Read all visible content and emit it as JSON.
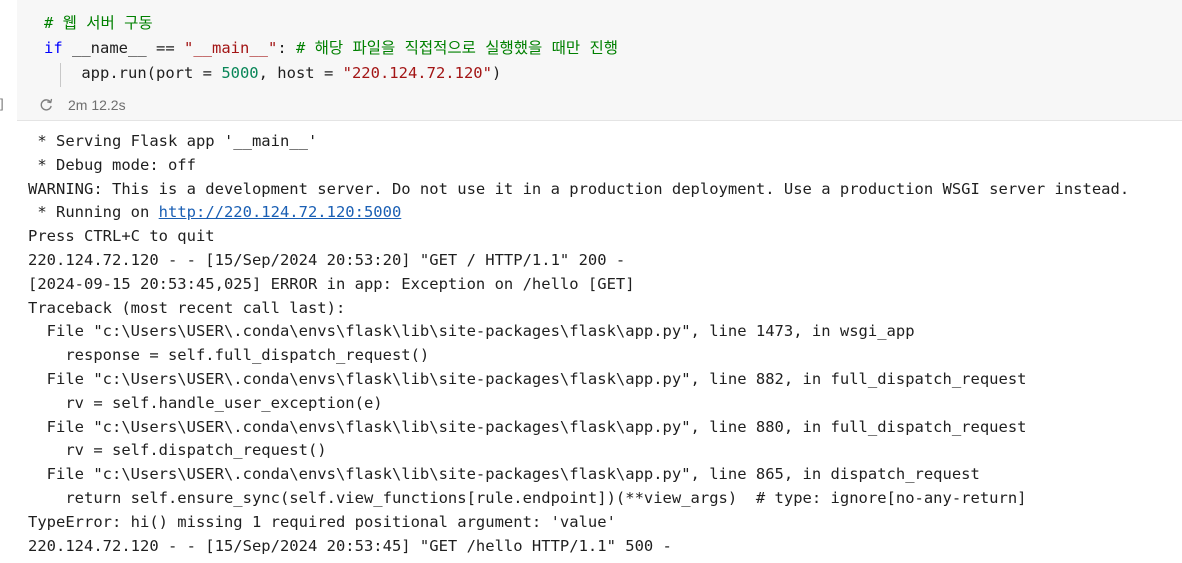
{
  "cell": {
    "code_lines": [
      [
        {
          "text": "# 웹 서버 구동",
          "style": "comment"
        }
      ],
      [
        {
          "text": "if",
          "style": "keyword"
        },
        {
          "text": " __name__ == ",
          "style": "plain"
        },
        {
          "text": "\"__main__\"",
          "style": "string"
        },
        {
          "text": ": ",
          "style": "plain"
        },
        {
          "text": "# 해당 파일을 직접적으로 실행했을 때만 진행",
          "style": "comment"
        }
      ],
      [
        {
          "text": "    app.run(port = ",
          "style": "plain"
        },
        {
          "text": "5000",
          "style": "number"
        },
        {
          "text": ", host = ",
          "style": "plain"
        },
        {
          "text": "\"220.124.72.120\"",
          "style": "string"
        },
        {
          "text": ")",
          "style": "plain"
        }
      ]
    ],
    "exec_time": "2m 12.2s",
    "status_icon": "refresh-icon",
    "left_marker": "]"
  },
  "colors": {
    "comment": "#008000",
    "keyword": "#0000ff",
    "string": "#a31515",
    "number": "#098658",
    "link": "#1a5fb4"
  },
  "output": {
    "lines": [
      {
        "text": " * Serving Flask app '__main__'"
      },
      {
        "text": " * Debug mode: off"
      },
      {
        "text": "WARNING: This is a development server. Do not use it in a production deployment. Use a production WSGI server instead."
      },
      {
        "prefix": " * Running on ",
        "link": "http://220.124.72.120:5000"
      },
      {
        "text": "Press CTRL+C to quit"
      },
      {
        "text": "220.124.72.120 - - [15/Sep/2024 20:53:20] \"GET / HTTP/1.1\" 200 -"
      },
      {
        "text": "[2024-09-15 20:53:45,025] ERROR in app: Exception on /hello [GET]"
      },
      {
        "text": "Traceback (most recent call last):"
      },
      {
        "text": "  File \"c:\\Users\\USER\\.conda\\envs\\flask\\lib\\site-packages\\flask\\app.py\", line 1473, in wsgi_app"
      },
      {
        "text": "    response = self.full_dispatch_request()"
      },
      {
        "text": "  File \"c:\\Users\\USER\\.conda\\envs\\flask\\lib\\site-packages\\flask\\app.py\", line 882, in full_dispatch_request"
      },
      {
        "text": "    rv = self.handle_user_exception(e)"
      },
      {
        "text": "  File \"c:\\Users\\USER\\.conda\\envs\\flask\\lib\\site-packages\\flask\\app.py\", line 880, in full_dispatch_request"
      },
      {
        "text": "    rv = self.dispatch_request()"
      },
      {
        "text": "  File \"c:\\Users\\USER\\.conda\\envs\\flask\\lib\\site-packages\\flask\\app.py\", line 865, in dispatch_request"
      },
      {
        "text": "    return self.ensure_sync(self.view_functions[rule.endpoint])(**view_args)  # type: ignore[no-any-return]"
      },
      {
        "text": "TypeError: hi() missing 1 required positional argument: 'value'"
      },
      {
        "text": "220.124.72.120 - - [15/Sep/2024 20:53:45] \"GET /hello HTTP/1.1\" 500 -"
      }
    ]
  }
}
